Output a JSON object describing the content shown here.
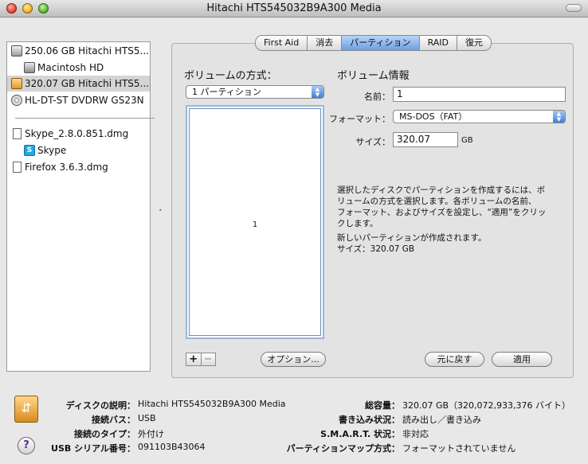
{
  "window": {
    "title": "Hitachi HTS545032B9A300 Media"
  },
  "sidebar": {
    "items": [
      {
        "label": "250.06 GB Hitachi HTS5..."
      },
      {
        "label": "Macintosh HD"
      },
      {
        "label": "320.07 GB Hitachi HTS5..."
      },
      {
        "label": "HL-DT-ST DVDRW GS23N"
      },
      {
        "label": "Skype_2.8.0.851.dmg"
      },
      {
        "label": "Skype"
      },
      {
        "label": "Firefox 3.6.3.dmg"
      }
    ]
  },
  "tabs": [
    {
      "label": "First Aid"
    },
    {
      "label": "消去"
    },
    {
      "label": "パーティション"
    },
    {
      "label": "RAID"
    },
    {
      "label": "復元"
    }
  ],
  "partition": {
    "scheme_label": "ボリュームの方式：",
    "scheme_value": "1 パーティション",
    "map_partition_label": "1",
    "plus": "+",
    "minus": "−",
    "options_button": "オプション..."
  },
  "volume_info": {
    "heading": "ボリューム情報",
    "name_label": "名前：",
    "name_value": "1",
    "format_label": "フォーマット：",
    "format_value": "MS-DOS（FAT）",
    "size_label": "サイズ：",
    "size_value": "320.07",
    "size_unit": "GB",
    "description_lines": [
      "選択したディスクでパーティションを作成するには、ボ",
      "リュームの方式を選択します。各ボリュームの名前、",
      "フォーマット、およびサイズを設定し、“適用”をクリッ",
      "クします。"
    ],
    "status_lines": [
      "新しいパーティションが作成されます。",
      "サイズ：320.07 GB"
    ],
    "revert_button": "元に戻す",
    "apply_button": "適用"
  },
  "footer": {
    "help_icon": "?",
    "left": [
      {
        "label": "ディスクの説明：",
        "value": "Hitachi HTS545032B9A300 Media"
      },
      {
        "label": "接続バス：",
        "value": "USB"
      },
      {
        "label": "接続のタイプ：",
        "value": "外付け"
      },
      {
        "label": "USB シリアル番号：",
        "value": "091103B43064"
      }
    ],
    "right": [
      {
        "label": "総容量：",
        "value": "320.07 GB（320,072,933,376 バイト）"
      },
      {
        "label": "書き込み状況：",
        "value": "読み出し／書き込み"
      },
      {
        "label": "S.M.A.R.T. 状況：",
        "value": "非対応"
      },
      {
        "label": "パーティションマップ方式：",
        "value": "フォーマットされていません"
      }
    ]
  }
}
